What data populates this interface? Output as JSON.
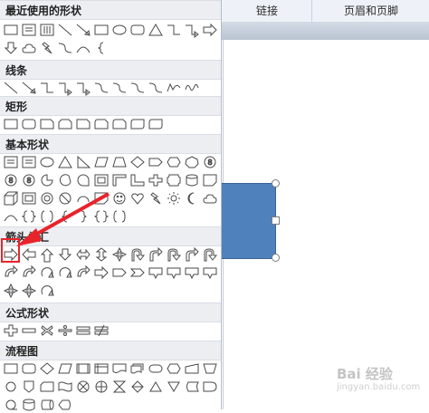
{
  "ribbon": {
    "tab_link": "链接",
    "tab_header_footer": "页眉和页脚"
  },
  "panel": {
    "sections": {
      "recent": "最近使用的形状",
      "lines": "线条",
      "rectangles": "矩形",
      "basic": "基本形状",
      "block_arrows": "箭头总汇",
      "equation": "公式形状",
      "flowchart": "流程图"
    },
    "selected_shape": "right-arrow"
  },
  "watermark": {
    "text": "Bai 经验",
    "url": "jingyan.baidu.com"
  },
  "colors": {
    "accent_shape": "#4f81bd",
    "highlight": "#e8242b",
    "section_bg": "#eceef2"
  }
}
